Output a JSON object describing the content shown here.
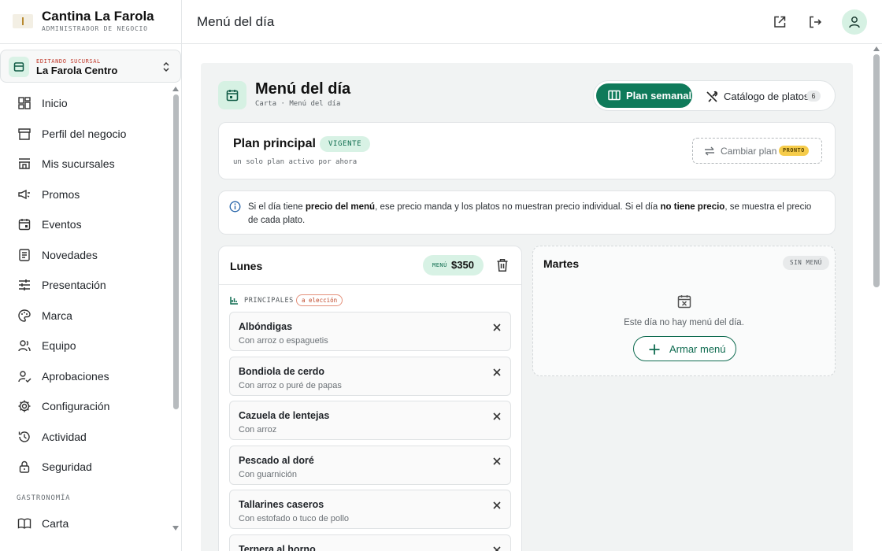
{
  "brand": {
    "title": "Cantina La Farola",
    "subtitle": "ADMINISTRADOR DE NEGOCIO"
  },
  "branch": {
    "tag": "EDITANDO SUCURSAL",
    "name": "La Farola Centro"
  },
  "nav": {
    "items": [
      {
        "label": "Inicio",
        "icon": "dashboard-icon"
      },
      {
        "label": "Perfil del negocio",
        "icon": "store-icon"
      },
      {
        "label": "Mis sucursales",
        "icon": "branches-icon"
      },
      {
        "label": "Promos",
        "icon": "megaphone-icon"
      },
      {
        "label": "Eventos",
        "icon": "calendar-icon"
      },
      {
        "label": "Novedades",
        "icon": "news-icon"
      },
      {
        "label": "Presentación",
        "icon": "sliders-icon"
      },
      {
        "label": "Marca",
        "icon": "palette-icon"
      },
      {
        "label": "Equipo",
        "icon": "team-icon"
      },
      {
        "label": "Aprobaciones",
        "icon": "user-check-icon"
      },
      {
        "label": "Configuración",
        "icon": "gear-icon"
      },
      {
        "label": "Actividad",
        "icon": "history-icon"
      },
      {
        "label": "Seguridad",
        "icon": "lock-icon"
      }
    ],
    "section": "GASTRONOMÍA",
    "carta": "Carta"
  },
  "topbar": {
    "title": "Menú del día"
  },
  "page": {
    "title": "Menú del día",
    "crumb": "Carta · Menú del día",
    "tab_weekly": "Plan semanal",
    "tab_catalog": "Catálogo de platos",
    "catalog_count": "6"
  },
  "plan": {
    "title": "Plan principal",
    "badge": "VIGENTE",
    "subtitle": "un solo plan activo por ahora",
    "change_label": "Cambiar plan",
    "change_badge": "PRONTO"
  },
  "info": {
    "t1": "Si el día tiene ",
    "b1": "precio del menú",
    "t2": ", ese precio manda y los platos no muestran precio individual. Si el día ",
    "b2": "no tiene precio",
    "t3": ", se muestra el precio de cada plato."
  },
  "monday": {
    "name": "Lunes",
    "price_label": "MENÚ",
    "price": "$350",
    "category": "PRINCIPALES",
    "category_tag": "a elección",
    "dishes": [
      {
        "name": "Albóndigas",
        "desc": "Con arroz o espaguetis"
      },
      {
        "name": "Bondiola de cerdo",
        "desc": "Con arroz o puré de papas"
      },
      {
        "name": "Cazuela de lentejas",
        "desc": "Con arroz"
      },
      {
        "name": "Pescado al doré",
        "desc": "Con guarnición"
      },
      {
        "name": "Tallarines caseros",
        "desc": "Con estofado o tuco de pollo"
      },
      {
        "name": "Ternera al horno",
        "desc": ""
      }
    ]
  },
  "tuesday": {
    "name": "Martes",
    "badge": "SIN MENÚ",
    "empty": "Este día no hay menú del día.",
    "button": "Armar menú"
  },
  "colors": {
    "accent": "#0f7a5a",
    "accent_soft": "#d8f2e5",
    "warning": "#f6cc4b"
  }
}
